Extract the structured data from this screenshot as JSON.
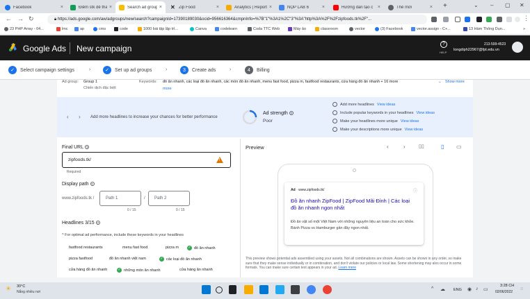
{
  "browser": {
    "tabs": [
      {
        "label": "Facebook",
        "color": "#1877f2"
      },
      {
        "label": "Điểm stk để thanh",
        "color": "#0f9d58"
      },
      {
        "label": "Search ad group:",
        "color": "#fbbc04"
      },
      {
        "label": "Zip Food",
        "color": "#202124"
      },
      {
        "label": "Analytics | Report",
        "color": "#f9ab00"
      },
      {
        "label": "NỘP LAB 6",
        "color": "#4285f4"
      },
      {
        "label": "Hướng dẫn tạo c",
        "color": "#ff0000"
      },
      {
        "label": "Thẻ mới",
        "color": "#5f6368"
      }
    ],
    "active_tab_index": 2,
    "url": "https://ads.google.com/aw/adgroups/new/search?campaignId=17390189030&ocid=956616364&cmpnInfo=%7B\"1\"%3A1%2C\"3\"%3A\"http%3A%2F%2Fzipfoods.tk%2F\"...",
    "bookmarks": [
      "23 PHP Array - 04...",
      "lmc",
      "ap",
      "cms",
      "code",
      "1000 bài tập lập trì...",
      "Canva",
      "codelearn",
      "Coda TTC Web",
      "Máy ảo",
      "classroom",
      "vector",
      "(3) Facebook",
      "vector.assign - C+...",
      "13 Hàm Thông Dụn..."
    ]
  },
  "header": {
    "brand": "Google Ads",
    "title": "New campaign",
    "help_label": "HELP",
    "account_phone": "213-599-4523",
    "account_email": "longdiph22967@fpt.edu.vn"
  },
  "stepper": [
    {
      "label": "Select campaign settings",
      "state": "done"
    },
    {
      "label": "Set up ad groups",
      "state": "done"
    },
    {
      "label": "Create ads",
      "state": "current",
      "number": "3"
    },
    {
      "label": "Billing",
      "state": "todo",
      "number": "4"
    }
  ],
  "ad_group_row": {
    "ad_group_label": "Ad group:",
    "group_name": "Group 1",
    "campaign_name": "Chiến dịch đặc biệt",
    "keywords_label": "Keywords:",
    "keywords_text": "đồ ăn nhanh, các loại đồ ăn nhanh, các món đồ ăn nhanh, menu fast food, pizza m, fastfood restaurants, cửa hàng đồ ăn nhanh + 16 more",
    "show_more": "Show more"
  },
  "ad_strength": {
    "prompt": "Add more headlines to increase your chances for better performance",
    "label": "Ad strength",
    "value": "Poor",
    "suggestions": [
      {
        "text": "Add more headlines",
        "link": "View ideas"
      },
      {
        "text": "Include popular keywords in your headlines",
        "link": "View ideas"
      },
      {
        "text": "Make your headlines more unique",
        "link": "View ideas"
      },
      {
        "text": "Make your descriptions more unique",
        "link": "View ideas"
      }
    ]
  },
  "form": {
    "final_url_label": "Final URL",
    "final_url_value": "zipfoods.tk/",
    "required_text": "Required",
    "display_path_label": "Display path",
    "display_domain": "www.zipfoods.tk /",
    "path1_placeholder": "Path 1",
    "path2_placeholder": "Path 2",
    "path1_count": "0 / 15",
    "path2_count": "0 / 15",
    "headlines_label": "Headlines 3/15",
    "headlines_info": "For optimal ad performance, include these keywords in your headlines",
    "keywords": [
      {
        "text": "fastfood restaurants",
        "used": false
      },
      {
        "text": "menu fast food",
        "used": false
      },
      {
        "text": "pizza m",
        "used": false
      },
      {
        "text": "đồ ăn nhanh",
        "used": true
      },
      {
        "text": "pizza fastfood",
        "used": false
      },
      {
        "text": "đồ ăn nhanh việt nam",
        "used": false
      },
      {
        "text": "các loại đồ ăn nhanh",
        "used": true
      },
      {
        "text": "cửa hàng đồ ăn nhanh",
        "used": false
      },
      {
        "text": "những món ăn nhanh",
        "used": true
      },
      {
        "text": "cửa hàng ăn nhanh",
        "used": false
      }
    ]
  },
  "preview": {
    "title": "Preview",
    "ad_label": "Ad",
    "ad_domain": "· www.zipfoods.tk/",
    "headline": "Đồ ăn nhanh ZipFood | ZipFood Mãi Đỉnh | Các loại đồ ăn nhanh ngon nhất",
    "description": "Đồ ăn vặt số một Việt Nam với những nguyên liệu an toàn cho sức khỏe. Bánh Pizza vs Hamburger gần đây ngon nhất.",
    "note": "This preview shows potential ads assembled using your assets. Not all combinations are shown. Assets can be shown in any order, so make sure that they make sense individually or in combination, and don't violate our policies or local law. Some shortening may also occur in some formats. You can make sure certain text appears in your ad.",
    "learn_more": "Learn more"
  },
  "taskbar": {
    "weather_temp": "30°C",
    "weather_desc": "Nắng nhiều nơi",
    "language": "ENG",
    "time": "3:28 CH",
    "date": "02/06/2022"
  },
  "colors": {
    "accent": "#1a73e8",
    "header_bg": "#1a1a1a",
    "success": "#34a853",
    "warning": "#e37400"
  }
}
